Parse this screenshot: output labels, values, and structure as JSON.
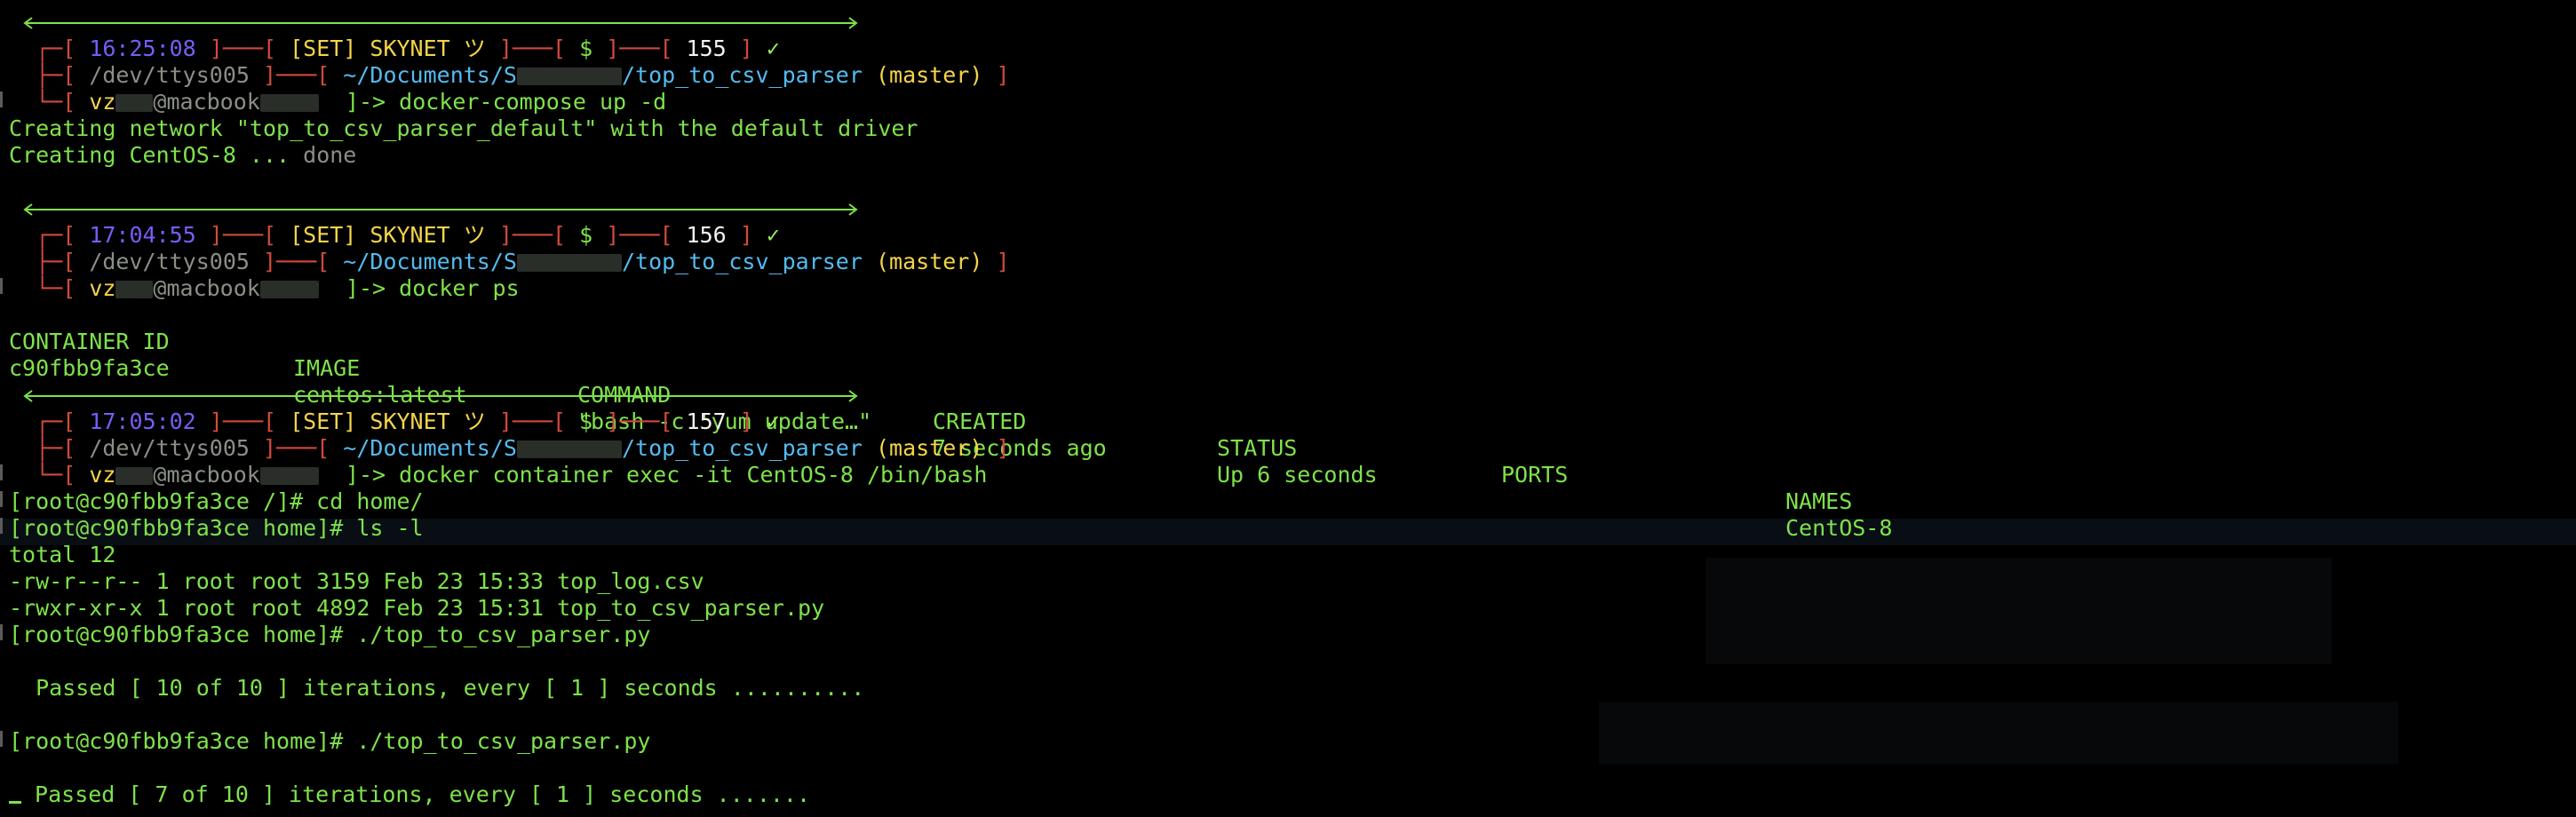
{
  "colors": {
    "background": "#000000",
    "text": "#7ee24b",
    "bracket": "#d24a3c",
    "time": "#7a5cf5",
    "set": "#f4d44a",
    "path": "#54bbf0",
    "dim": "#8a8f86"
  },
  "prompt_common": {
    "set": "[SET] SKYNET ツ",
    "dollar": "$",
    "check": "✓",
    "tty": "/dev/ttys005",
    "cwd_prefix": "~/Documents/S",
    "cwd_suffix": "/top_to_csv_parser",
    "branch": "(master)",
    "user": "vz",
    "host": "@macbook",
    "arrow": "]-> "
  },
  "blocks": [
    {
      "time": "16:25:08",
      "count": "155",
      "command": "docker-compose up -d",
      "output": [
        "Creating network \"top_to_csv_parser_default\" with the default driver",
        "Creating CentOS-8 ... "
      ],
      "status_word": "done"
    },
    {
      "time": "17:04:55",
      "count": "156",
      "command": "docker ps",
      "table": {
        "headers": [
          "CONTAINER ID",
          "IMAGE",
          "COMMAND",
          "CREATED",
          "STATUS",
          "PORTS",
          "NAMES"
        ],
        "rows": [
          [
            "c90fbb9fa3ce",
            "centos:latest",
            "\"bash -c 'yum update…\"",
            "7 seconds ago",
            "Up 6 seconds",
            "",
            "CentOS-8"
          ]
        ]
      }
    },
    {
      "time": "17:05:02",
      "count": "157",
      "command": "docker container exec -it CentOS-8 /bin/bash"
    }
  ],
  "container_session": {
    "lines": [
      "[root@c90fbb9fa3ce /]# cd home/",
      "[root@c90fbb9fa3ce home]# ls -l",
      "total 12",
      "-rw-r--r-- 1 root root 3159 Feb 23 15:33 top_log.csv",
      "-rwxr-xr-x 1 root root 4892 Feb 23 15:31 top_to_csv_parser.py",
      "[root@c90fbb9fa3ce home]# ./top_to_csv_parser.py",
      "  Passed [ 10 of 10 ] iterations, every [ 1 ] seconds ..........",
      "[root@c90fbb9fa3ce home]# ./top_to_csv_parser.py",
      " Passed [ 7 of 10 ] iterations, every [ 1 ] seconds ......."
    ]
  }
}
